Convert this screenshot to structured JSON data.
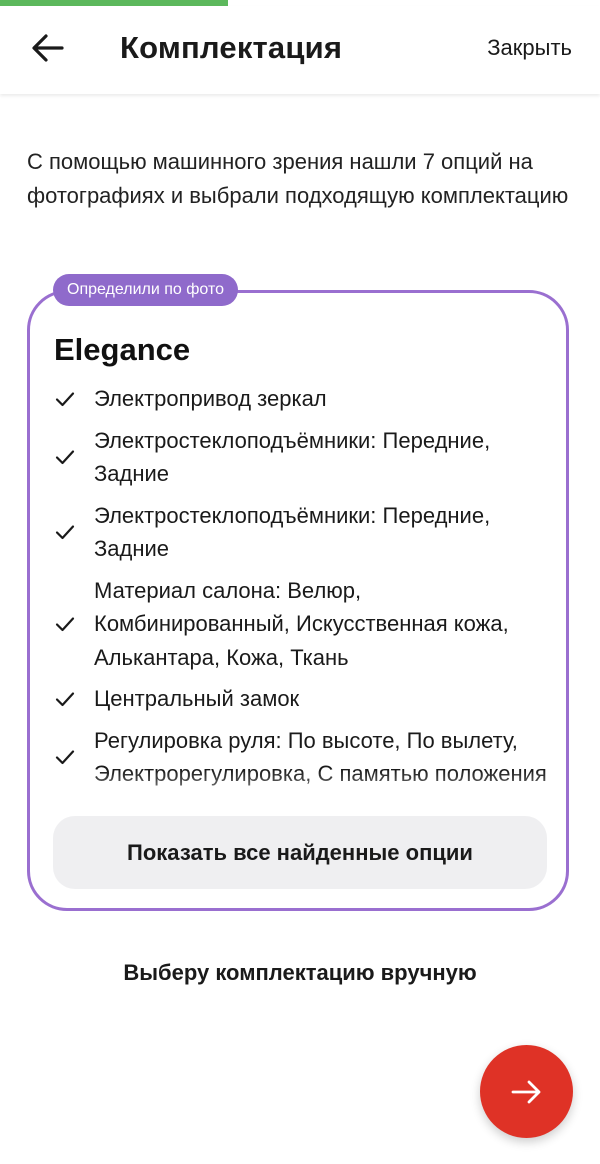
{
  "progress": {
    "fraction": 0.38,
    "color": "#5cb85c"
  },
  "header": {
    "back_icon": "arrow-left-icon",
    "title": "Комплектация",
    "close_label": "Закрыть"
  },
  "intro_text": "С помощью машинного зрения нашли 7 опций на фотографиях и выбрали подходящую комплектацию",
  "card": {
    "badge": "Определили по фото",
    "accent_color": "#9a6fd0",
    "trim_name": "Elegance",
    "options": [
      {
        "text": "Электропривод зеркал"
      },
      {
        "text": "Электростеклоподъёмники: Передние, Задние"
      },
      {
        "text": "Электростеклоподъёмники: Передние, Задние"
      },
      {
        "text": "Материал салона: Велюр, Комбинированный, Искусственная кожа, Алькантара, Кожа, Ткань"
      },
      {
        "text": "Центральный замок"
      },
      {
        "text": "Регулировка руля: По высоте, По вылету, Электрорегулировка, С памятью положения"
      }
    ],
    "show_all_label": "Показать все найденные опции"
  },
  "manual_label": "Выберу комплектацию вручную",
  "fab": {
    "icon": "arrow-right-icon",
    "color": "#df3226"
  }
}
